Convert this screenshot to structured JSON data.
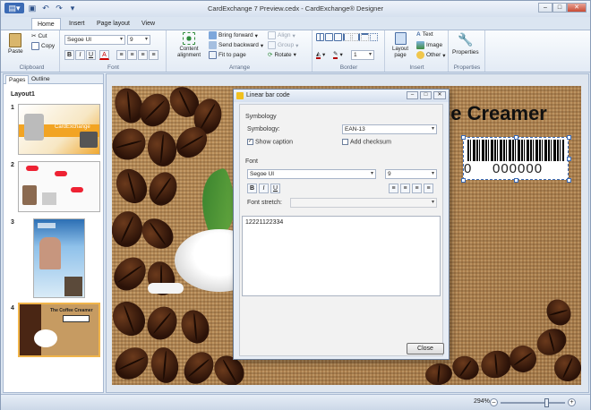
{
  "window": {
    "title": "CardExchange 7 Preview.cedx - CardExchange® Designer"
  },
  "ribbon": {
    "tabs": [
      "Home",
      "Insert",
      "Page layout",
      "View"
    ],
    "clipboard": {
      "paste": "Paste",
      "cut": "Cut",
      "copy": "Copy",
      "label": "Clipboard"
    },
    "font": {
      "family": "Segoe UI",
      "size": "9",
      "label": "Font",
      "bold": "B",
      "italic": "I",
      "underline": "U",
      "color": "A"
    },
    "arrange": {
      "content_alignment": "Content alignment",
      "bring_forward": "Bring forward",
      "send_backward": "Send backward",
      "fit_to_page": "Fit to page",
      "align": "Align",
      "group": "Group",
      "rotate": "Rotate",
      "label": "Arrange"
    },
    "border": {
      "size": "1",
      "label": "Border"
    },
    "insert": {
      "layout_page": "Layout page",
      "text": "Text",
      "image": "Image",
      "other": "Other",
      "label": "Insert"
    },
    "properties": {
      "properties": "Properties",
      "label": "Properties"
    }
  },
  "pages_panel": {
    "tabs": [
      "Pages",
      "Outline"
    ],
    "layout_title": "Layout1",
    "pages": [
      "1",
      "2",
      "3",
      "4"
    ],
    "thumb1_text": "CardExchange",
    "thumb4_text": "The Coffee Creamer"
  },
  "card": {
    "heading": "ee Creamer",
    "barcode_digits": "000000",
    "barcode_first": "0"
  },
  "dialog": {
    "title": "Linear bar code",
    "symbology_section": "Symbology",
    "symbology_label": "Symbology:",
    "symbology_value": "EAN-13",
    "show_caption": "Show caption",
    "show_caption_checked": "✓",
    "add_checksum": "Add checksum",
    "font_section": "Font",
    "font_family": "Segoe UI",
    "font_size": "9",
    "bold": "B",
    "italic": "I",
    "underline": "U",
    "font_stretch_label": "Font stretch:",
    "value": "12221122334",
    "close": "Close"
  },
  "status": {
    "zoom": "294%"
  }
}
